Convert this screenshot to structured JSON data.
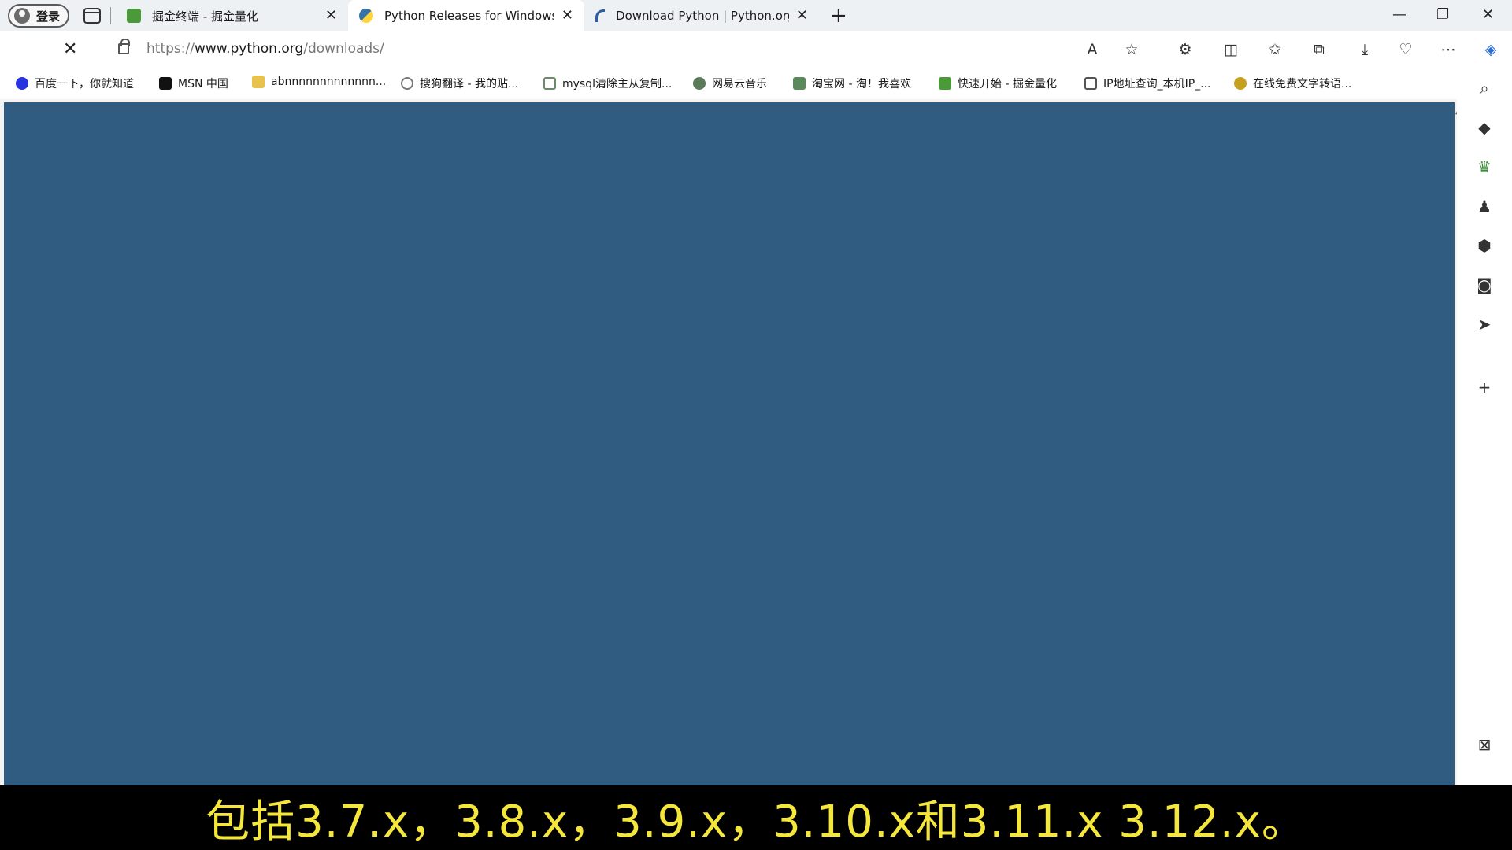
{
  "profile": {
    "label": "登录",
    "icon": "person-icon"
  },
  "tabs": [
    {
      "title": "掘金终端 - 掘金量化",
      "favicon": "juejin-icon",
      "active": false
    },
    {
      "title": "Python Releases for Windows | P",
      "favicon": "python-icon",
      "active": true
    },
    {
      "title": "Download Python | Python.org",
      "favicon": "loading-spinner-icon",
      "active": false
    }
  ],
  "address": {
    "scheme": "https://",
    "host": "www.python.org",
    "path": "/downloads/"
  },
  "favorites": [
    {
      "label": "百度一下，你就知道",
      "icon": "baidu-paw-icon",
      "color": "#2932e1"
    },
    {
      "label": "MSN 中国",
      "icon": "msn-icon",
      "color": "#111111"
    },
    {
      "label": "abnnnnnnnnnnnnn...",
      "icon": "folder-icon",
      "color": "#e8c24a"
    },
    {
      "label": "搜狗翻译 - 我的贴...",
      "icon": "sogou-icon",
      "color": "#777777"
    },
    {
      "label": "mysql清除主从复制...",
      "icon": "page-icon",
      "color": "#6a8a6a"
    },
    {
      "label": "网易云音乐",
      "icon": "netease-music-icon",
      "color": "#5a7a5a"
    },
    {
      "label": "淘宝网 - 淘！我喜欢",
      "icon": "taobao-icon",
      "color": "#5a8a5a"
    },
    {
      "label": "快速开始 - 掘金量化",
      "icon": "juejin-icon",
      "color": "#4a9a3a"
    },
    {
      "label": "IP地址查询_本机IP_...",
      "icon": "ip-lookup-icon",
      "color": "#555555"
    },
    {
      "label": "在线免费文字转语...",
      "icon": "tts-icon",
      "color": "#c8a020"
    }
  ],
  "subtitle": "包括3.7.x，3.8.x，3.9.x，3.10.x和3.11.x 3.12.x。",
  "colors": {
    "content_bg": "#305c82",
    "subtitle_text": "#f4e63a"
  }
}
